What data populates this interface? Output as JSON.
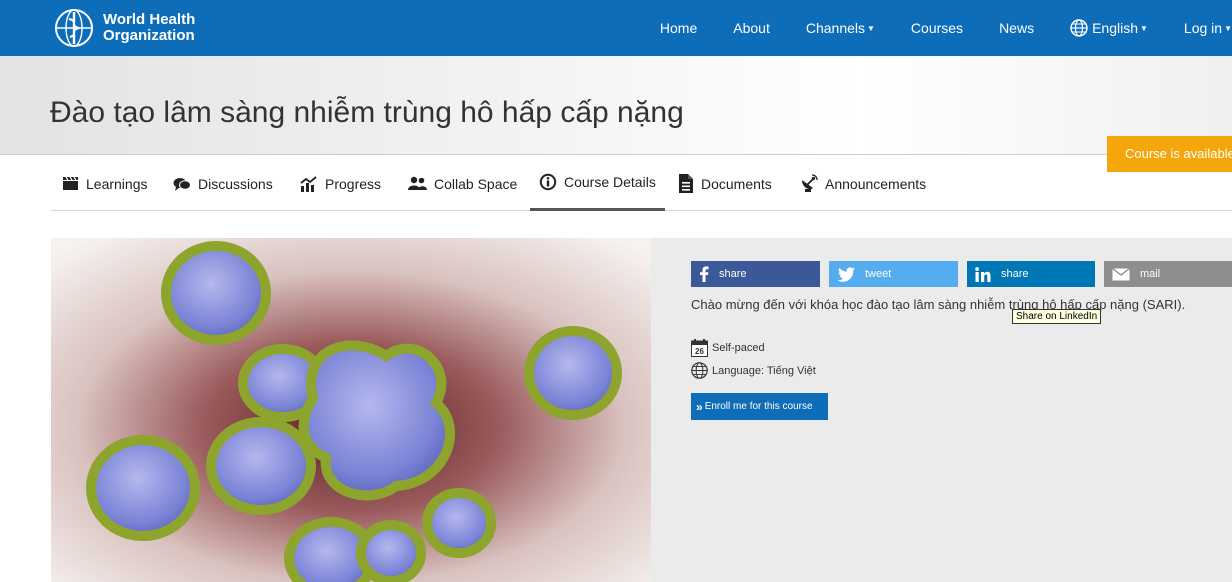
{
  "header": {
    "logo_line1": "World Health",
    "logo_line2": "Organization",
    "nav": {
      "home": "Home",
      "about": "About",
      "channels": "Channels",
      "courses": "Courses",
      "news": "News",
      "language": "English",
      "login": "Log in"
    }
  },
  "course": {
    "title": "Đào tạo lâm sàng nhiễm trùng hô hấp cấp nặng",
    "availability_badge": "Course is available"
  },
  "tabs": {
    "learnings": "Learnings",
    "discussions": "Discussions",
    "progress": "Progress",
    "collab": "Collab Space",
    "details": "Course Details",
    "documents": "Documents",
    "announcements": "Announcements"
  },
  "share": {
    "facebook": "share",
    "twitter": "tweet",
    "linkedin": "share",
    "mail": "mail"
  },
  "details": {
    "intro": "Chào mừng đến với khóa học đào tạo lâm sàng nhiễm trùng hô hấp cấp nặng (SARI).",
    "tooltip": "Share on LinkedIn",
    "pace": "Self-paced",
    "calendar_day": "26",
    "language": "Language: Tiếng Việt",
    "enroll": "Enroll me for this course"
  },
  "colors": {
    "brand_blue": "#0e6db8",
    "badge_orange": "#f4a60b",
    "facebook": "#3b5998",
    "twitter": "#55acee",
    "linkedin": "#0077b5",
    "mail": "#8e8e8e"
  },
  "icons": [
    "who-emblem-icon",
    "caret-down-icon",
    "globe-icon",
    "clapperboard-icon",
    "chat-icon",
    "chart-icon",
    "people-icon",
    "info-icon",
    "document-icon",
    "satellite-icon",
    "facebook-icon",
    "twitter-icon",
    "linkedin-icon",
    "mail-icon",
    "calendar-icon",
    "double-chevron-icon"
  ]
}
